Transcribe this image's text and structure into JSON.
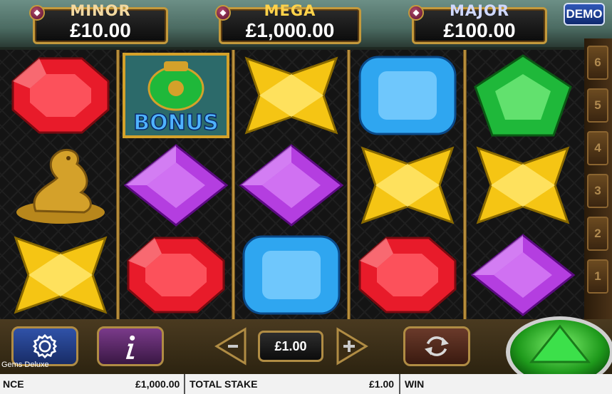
{
  "jackpots": {
    "minor": {
      "title": "MINOR",
      "value": "£10.00",
      "title_color": "#f3d9a0"
    },
    "mega": {
      "title": "MEGA",
      "value": "£1,000.00",
      "title_color": "#ffd24a"
    },
    "major": {
      "title": "MAJOR",
      "value": "£100.00",
      "title_color": "#cfd8ff"
    }
  },
  "demo_label": "DEMO",
  "reels": [
    [
      "red-gem",
      "gold-dragon",
      "yellow-gem"
    ],
    [
      "bonus-pot",
      "purple-gem",
      "red-gem"
    ],
    [
      "yellow-gem",
      "purple-gem",
      "blue-gem"
    ],
    [
      "blue-gem",
      "yellow-gem",
      "red-gem"
    ],
    [
      "green-gem",
      "yellow-gem",
      "purple-gem"
    ]
  ],
  "bonus_label": "BONUS",
  "paylines": [
    "6",
    "5",
    "4",
    "3",
    "2",
    "1"
  ],
  "controls": {
    "stake": "£1.00",
    "minus": "−",
    "plus": "+"
  },
  "game_name": "Gems Deluxe",
  "infobar": {
    "balance_label": "NCE",
    "balance_value": "£1,000.00",
    "total_stake_label": "TOTAL STAKE",
    "total_stake_value": "£1.00",
    "win_label": "WIN"
  },
  "colors": {
    "red-gem": "#e81b2a",
    "yellow-gem": "#f5c514",
    "purple-gem": "#b43ee0",
    "blue-gem": "#2fa6f0",
    "green-gem": "#1fb83a",
    "gold": "#d4a12a"
  }
}
